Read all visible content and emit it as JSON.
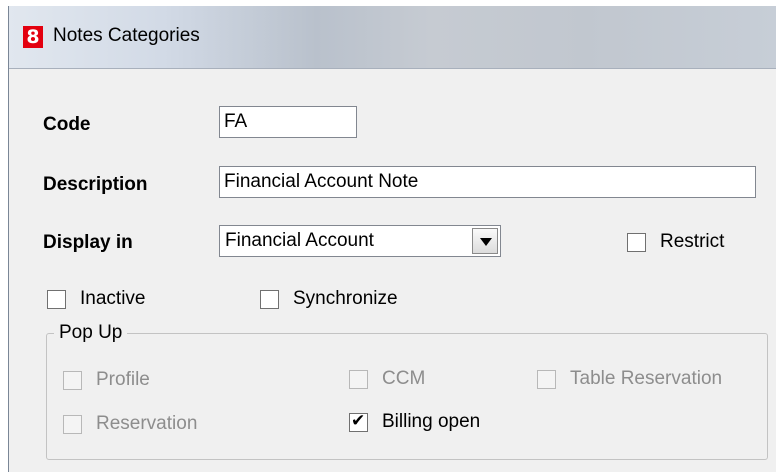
{
  "window": {
    "app_icon_text": "8",
    "app_icon_color": "#e3000f",
    "title": "Notes Categories"
  },
  "form": {
    "code_label": "Code",
    "code_value": "FA",
    "description_label": "Description",
    "description_value": "Financial Account Note",
    "display_in_label": "Display in",
    "display_in_value": "Financial Account",
    "restrict_label": "Restrict",
    "restrict_checked": false,
    "inactive_label": "Inactive",
    "inactive_checked": false,
    "synchronize_label": "Synchronize",
    "synchronize_checked": false
  },
  "popup": {
    "legend": "Pop Up",
    "profile_label": "Profile",
    "profile_checked": false,
    "ccm_label": "CCM",
    "ccm_checked": false,
    "table_reservation_label": "Table Reservation",
    "table_reservation_checked": false,
    "reservation_label": "Reservation",
    "reservation_checked": false,
    "billing_open_label": "Billing open",
    "billing_open_checked": true,
    "check_glyph": "✔"
  }
}
